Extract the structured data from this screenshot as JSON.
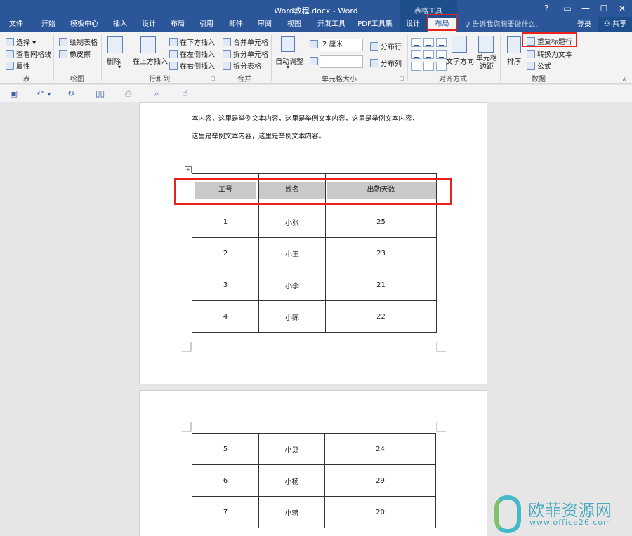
{
  "window": {
    "title": "Word教程.docx - Word",
    "context_label": "表格工具",
    "controls": [
      "?",
      "▭",
      "—",
      "☐",
      "✕"
    ]
  },
  "tabs": [
    {
      "label": "文件"
    },
    {
      "label": "开始"
    },
    {
      "label": "模板中心"
    },
    {
      "label": "插入"
    },
    {
      "label": "设计"
    },
    {
      "label": "布局"
    },
    {
      "label": "引用"
    },
    {
      "label": "邮件"
    },
    {
      "label": "审阅"
    },
    {
      "label": "视图"
    },
    {
      "label": "开发工具"
    },
    {
      "label": "PDF工具集"
    },
    {
      "label": "设计"
    },
    {
      "label": "布局"
    }
  ],
  "tell_me": "告诉我您想要做什么...",
  "login": "登录",
  "share": "共享",
  "ribbon": {
    "table": {
      "select": "选择 ▾",
      "gridlines": "查看网格线",
      "properties": "属性",
      "label": "表"
    },
    "draw": {
      "draw_table": "绘制表格",
      "eraser": "橡皮擦",
      "label": "绘图"
    },
    "rows_cols": {
      "delete": "删除",
      "insert_above": "在上方插入",
      "insert_below": "在下方插入",
      "insert_left": "在左侧插入",
      "insert_right": "在右侧插入",
      "label": "行和列"
    },
    "merge": {
      "merge_cells": "合并单元格",
      "split_cells": "拆分单元格",
      "split_table": "拆分表格",
      "label": "合并"
    },
    "cell_size": {
      "autofit": "自动调整",
      "height": "2 厘米",
      "width": "",
      "dist_rows": "分布行",
      "dist_cols": "分布列",
      "label": "单元格大小"
    },
    "alignment": {
      "text_dir": "文字方向",
      "margins": "单元格边距",
      "label": "对齐方式"
    },
    "data": {
      "sort": "排序",
      "repeat_header": "重复标题行",
      "to_text": "转换为文本",
      "formula": "公式",
      "label": "数据"
    }
  },
  "document": {
    "paragraph": [
      "本内容，这里是举例文本内容，这里是举例文本内容，这里是举例文本内容，",
      "这里是举例文本内容，这里是举例文本内容。"
    ],
    "table_headers": [
      "工号",
      "姓名",
      "出勤天数"
    ],
    "rows_page1": [
      [
        "1",
        "小张",
        "25"
      ],
      [
        "2",
        "小王",
        "23"
      ],
      [
        "3",
        "小李",
        "21"
      ],
      [
        "4",
        "小陈",
        "22"
      ]
    ],
    "rows_page2": [
      [
        "5",
        "小郑",
        "24"
      ],
      [
        "6",
        "小杨",
        "29"
      ],
      [
        "7",
        "小蒋",
        "20"
      ]
    ]
  },
  "watermark": {
    "title": "欧菲资源网",
    "url": "www.office26.com"
  },
  "colors": {
    "accent": "#2b579a",
    "highlight": "#e8231c",
    "header_fill": "#c9c9c9"
  }
}
